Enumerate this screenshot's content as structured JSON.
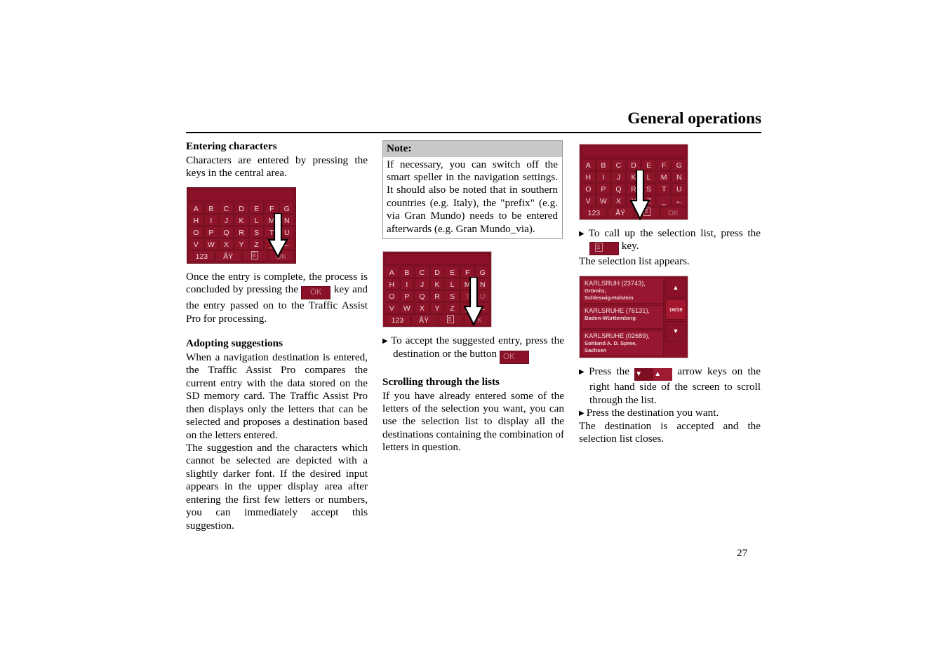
{
  "header": {
    "title": "General operations"
  },
  "page_number": "27",
  "column_left": {
    "section1_heading": "Entering characters",
    "section1_para": "Characters are entered by pressing the keys in the central area.",
    "after_keyboard_para_1": "Once the entry is complete, the process is concluded by pressing the ",
    "after_keyboard_ok": "OK",
    "after_keyboard_para_2": " key and the entry passed on to the Traffic Assist Pro for processing.",
    "section2_heading": "Adopting suggestions",
    "section2_para_1": "When a navigation destination is entered, the Traffic Assist Pro compares the current entry with the data stored on the SD memory card. The Traffic Assist Pro then displays only the letters that can be selected and proposes a destination based on the letters entered.",
    "section2_para_2": "The suggestion and the characters which cannot be selected are depicted with a slightly darker font. If the desired input appears in the upper display area after entering the first few letters or numbers, you can immediately accept this suggestion."
  },
  "column_middle": {
    "note_label": "Note:",
    "note_body": "If necessary, you can switch off the smart speller in the navigation settings. It should also be noted that in southern countries (e.g. Italy), the \"prefix\" (e.g. via Gran Mundo) needs to be entered afterwards (e.g. Gran Mundo_via).",
    "bullet_accept_1": "To accept the suggested entry, press the destination or the button ",
    "bullet_accept_ok": "OK",
    "section3_heading": "Scrolling through the lists",
    "section3_para": "If you have already entered some of the letters of the selection you want, you can use the selection list to display all the destinations containing the combination of letters in question."
  },
  "column_right": {
    "bullet_callup_1": "To call up the selection list, press the ",
    "bullet_callup_2": " key.",
    "after_callup": "The selection list appears.",
    "bullet_arrows_1": "Press the ",
    "bullet_arrows_2": " arrow keys on the right hand side of the screen to scroll through the list.",
    "bullet_press_destination": "Press the destination you want.",
    "after_press": "The destination is accepted and the selection list closes."
  },
  "keyboard": {
    "rows": [
      [
        "A",
        "B",
        "C",
        "D",
        "E",
        "F",
        "G"
      ],
      [
        "H",
        "I",
        "J",
        "K",
        "L",
        "M",
        "N"
      ],
      [
        "O",
        "P",
        "Q",
        "R",
        "S",
        "T",
        "U"
      ],
      [
        "V",
        "W",
        "X",
        "Y",
        "Z",
        "_",
        "←"
      ]
    ],
    "bottom_row": {
      "numeric": "123",
      "accents": "ÅŸ",
      "list_icon": "list-icon",
      "ok": "OK"
    },
    "display_value": ""
  },
  "selection_list": {
    "items": [
      {
        "title": "KARLSRUH (23743),",
        "lines": [
          "Grömitz,",
          "Schleswig-Holstein"
        ]
      },
      {
        "title": "KARLSRUHE (76131),",
        "lines": [
          "Baden-Württemberg"
        ]
      },
      {
        "title": "KARLSRUHE (02689),",
        "lines": [
          "Sohland A. D. Spree,",
          "Sachsen"
        ]
      }
    ],
    "scroll_up": "▲",
    "scroll_down": "▼",
    "counter": "16/19"
  },
  "inline_controls": {
    "arrow_down": "▼",
    "arrow_up": "▲",
    "bullet_marker": "▶"
  },
  "colors": {
    "device_red": "#8A1128",
    "device_key_red": "#8E1429",
    "device_key_text": "#F0D8DC",
    "device_dim_text": "#B06372",
    "note_header_grey": "#C8C8C8",
    "page_background": "#FFFFFF"
  }
}
